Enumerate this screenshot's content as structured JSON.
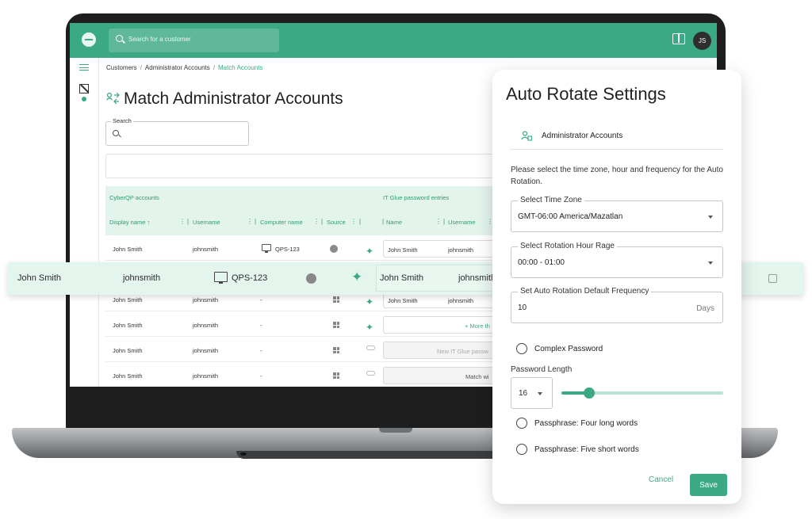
{
  "topbar": {
    "search_placeholder": "Search for a customer",
    "avatar_initials": "JS",
    "accent": "#3ba983"
  },
  "breadcrumb": [
    "Customers",
    "Administrator Accounts",
    "Match Accounts"
  ],
  "page": {
    "title": "Match Administrator Accounts",
    "search_label": "Search"
  },
  "grid": {
    "group_left": "CyberQP accounts",
    "group_right": "IT Glue password entries",
    "columns": [
      "Display name ↑",
      "Username",
      "Computer name",
      "Source",
      "Name",
      "Username"
    ],
    "rows": [
      {
        "display": "John Smith",
        "username": "johnsmith",
        "computer": "QPS-123",
        "pw_name": "John Smith",
        "pw_user": "johnsmith"
      },
      {
        "display": "John Smith",
        "username": "johnsmith",
        "computer": "-",
        "pw_name": "John Smith",
        "pw_user": "johnsmith"
      },
      {
        "display": "John Smith",
        "username": "johnsmith",
        "computer": "-",
        "pw_action": "+ More th"
      },
      {
        "display": "John Smith",
        "username": "johnsmith",
        "computer": "-",
        "pw_action": "New IT Glue passw"
      },
      {
        "display": "John Smith",
        "username": "johnsmith",
        "computer": "-",
        "pw_action": "Match wi"
      }
    ]
  },
  "highlight_row": {
    "display": "John Smith",
    "username": "johnsmith",
    "computer": "QPS-123",
    "pw_name": "John Smith",
    "pw_user": "johnsmith"
  },
  "modal": {
    "title": "Auto Rotate Settings",
    "section": "Administrator Accounts",
    "description": "Please select the time zone, hour and frequency for the Auto Rotation.",
    "timezone": {
      "label": "Select Time Zone",
      "value": "GMT-06:00 America/Mazatlan"
    },
    "hour": {
      "label": "Select Rotation Hour Rage",
      "value": "00:00 - 01:00"
    },
    "frequency": {
      "label": "Set Auto Rotation Default Frequency",
      "value": "10",
      "unit": "Days"
    },
    "complex_password": "Complex Password",
    "password_length": {
      "label": "Password Length",
      "value": "16",
      "slider_fraction": 0.17
    },
    "passphrase_long": "Passphrase: Four long words",
    "passphrase_short": "Passphrase: Five short words",
    "cancel": "Cancel",
    "save": "Save"
  }
}
